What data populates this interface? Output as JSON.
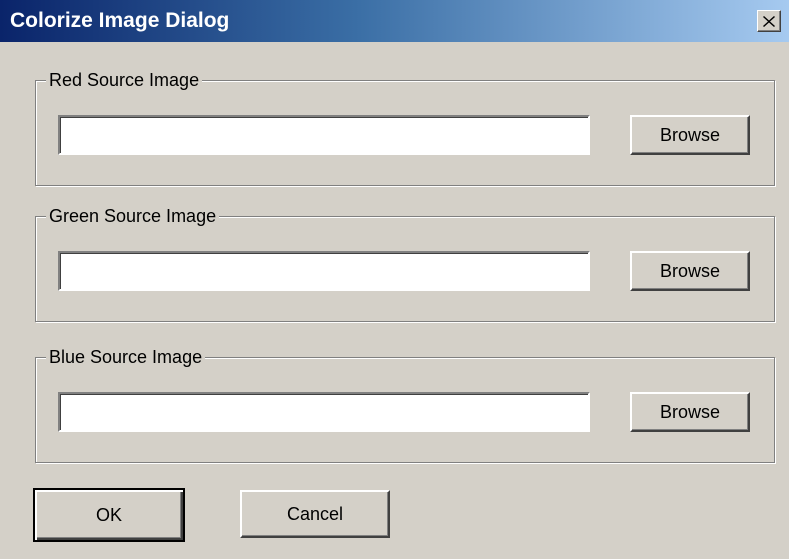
{
  "window": {
    "title": "Colorize Image Dialog",
    "close_icon": "close-icon"
  },
  "groups": [
    {
      "label": "Red Source Image",
      "input_value": "",
      "browse_label": "Browse"
    },
    {
      "label": "Green Source Image",
      "input_value": "",
      "browse_label": "Browse"
    },
    {
      "label": "Blue Source Image",
      "input_value": "",
      "browse_label": "Browse"
    }
  ],
  "footer": {
    "ok_label": "OK",
    "cancel_label": "Cancel"
  },
  "colors": {
    "titlebar_start": "#0a246a",
    "titlebar_end": "#a6caf0",
    "face": "#d4d0c8"
  }
}
